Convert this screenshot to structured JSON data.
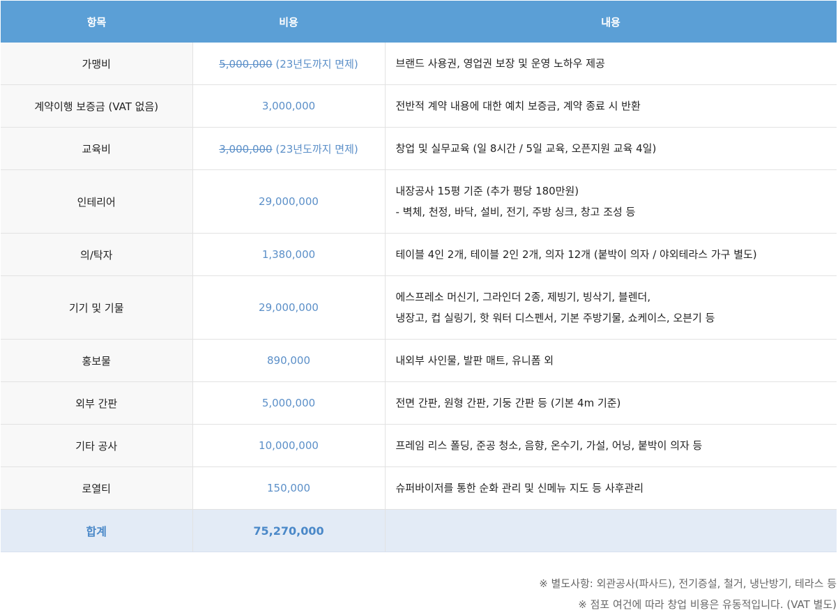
{
  "table": {
    "headers": [
      "항목",
      "비용",
      "내용"
    ],
    "rows": [
      {
        "item": "가맹비",
        "cost_struck": "5,000,000",
        "cost_note": " (23년도까지 면제)",
        "desc": [
          "브랜드 사용권, 영업권 보장 및 운영 노하우 제공"
        ]
      },
      {
        "item": "계약이행 보증금 (VAT 없음)",
        "cost": "3,000,000",
        "desc": [
          "전반적 계약 내용에 대한 예치 보증금, 계약 종료 시 반환"
        ]
      },
      {
        "item": "교육비",
        "cost_struck": "3,000,000",
        "cost_note": " (23년도까지 면제)",
        "desc": [
          "창업 및 실무교육 (일 8시간 / 5일 교육, 오픈지원 교육 4일)"
        ]
      },
      {
        "item": "인테리어",
        "cost": "29,000,000",
        "desc": [
          "내장공사 15평 기준 (추가 평당 180만원)",
          "- 벽체, 천정, 바닥, 설비, 전기, 주방 싱크, 창고 조성 등"
        ]
      },
      {
        "item": "의/탁자",
        "cost": "1,380,000",
        "desc": [
          "테이블 4인 2개, 테이블 2인 2개, 의자 12개 (붙박이 의자 / 야외테라스 가구 별도)"
        ]
      },
      {
        "item": "기기 및 기물",
        "cost": "29,000,000",
        "desc": [
          "에스프레소 머신기, 그라인더 2종, 제빙기, 빙삭기, 블렌더,",
          "냉장고, 컵 실링기, 핫 워터 디스펜서, 기본 주방기물, 쇼케이스, 오븐기 등"
        ]
      },
      {
        "item": "홍보물",
        "cost": "890,000",
        "desc": [
          "내외부 사인물, 발판 매트, 유니폼 외"
        ]
      },
      {
        "item": "외부 간판",
        "cost": "5,000,000",
        "desc": [
          "전면 간판, 원형 간판, 기둥 간판 등 (기본 4m 기준)"
        ]
      },
      {
        "item": "기타 공사",
        "cost": "10,000,000",
        "desc": [
          "프레임 리스 폴딩, 준공 청소, 음향, 온수기, 가설, 어닝, 붙박이 의자 등"
        ]
      },
      {
        "item": "로열티",
        "cost": "150,000",
        "desc": [
          "슈퍼바이저를 통한 순화 관리 및 신메뉴 지도 등 사후관리"
        ]
      }
    ],
    "total": {
      "label": "합계",
      "cost": "75,270,000"
    }
  },
  "notes": [
    "※ 별도사항: 외관공사(파사드), 전기증설, 철거, 냉난방기, 테라스 등",
    "※ 점포 여건에 따라 창업 비용은 유동적입니다. (VAT 별도)"
  ],
  "colors": {
    "header_bg": "#5b9fd6",
    "cost_text": "#5b8fc8",
    "total_bg": "#e3ebf6"
  }
}
